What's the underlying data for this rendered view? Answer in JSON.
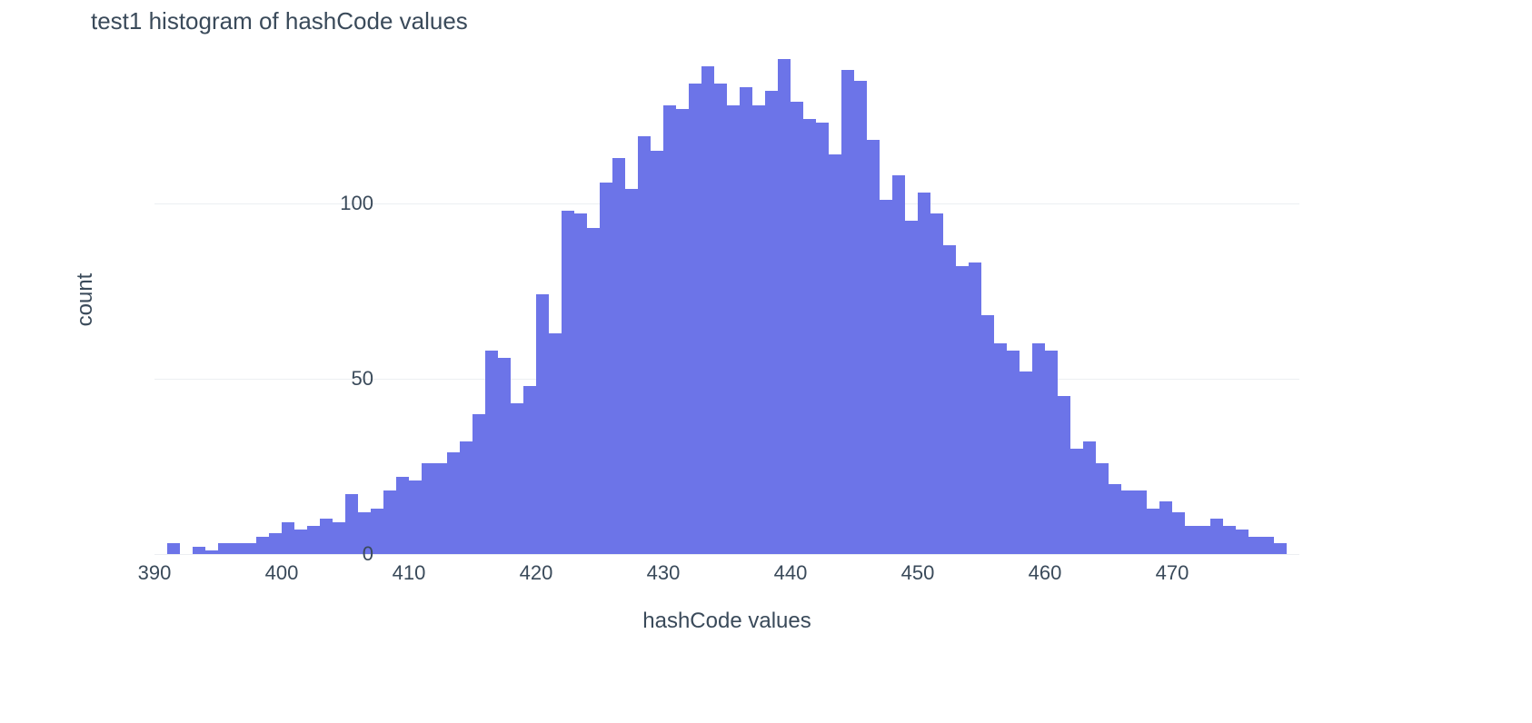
{
  "chart_data": {
    "type": "bar",
    "title": "test1 histogram of hashCode values",
    "xlabel": "hashCode values",
    "ylabel": "count",
    "x_ticks": [
      390,
      400,
      410,
      420,
      430,
      440,
      450,
      460,
      470
    ],
    "y_ticks": [
      0,
      50,
      100
    ],
    "xlim": [
      390,
      480
    ],
    "ylim": [
      0,
      145
    ],
    "categories": [
      390,
      391,
      392,
      393,
      394,
      395,
      396,
      397,
      398,
      399,
      400,
      401,
      402,
      403,
      404,
      405,
      406,
      407,
      408,
      409,
      410,
      411,
      412,
      413,
      414,
      415,
      416,
      417,
      418,
      419,
      420,
      421,
      422,
      423,
      424,
      425,
      426,
      427,
      428,
      429,
      430,
      431,
      432,
      433,
      434,
      435,
      436,
      437,
      438,
      439,
      440,
      441,
      442,
      443,
      444,
      445,
      446,
      447,
      448,
      449,
      450,
      451,
      452,
      453,
      454,
      455,
      456,
      457,
      458,
      459,
      460,
      461,
      462,
      463,
      464,
      465,
      466,
      467,
      468,
      469,
      470,
      471,
      472,
      473,
      474,
      475,
      476,
      477,
      478,
      479
    ],
    "values": [
      0,
      3,
      0,
      2,
      1,
      3,
      3,
      3,
      5,
      6,
      9,
      7,
      8,
      10,
      9,
      17,
      12,
      13,
      18,
      22,
      21,
      26,
      26,
      29,
      32,
      40,
      58,
      56,
      43,
      48,
      74,
      63,
      98,
      97,
      93,
      106,
      113,
      104,
      119,
      115,
      128,
      127,
      134,
      139,
      134,
      128,
      133,
      128,
      132,
      141,
      129,
      124,
      123,
      114,
      138,
      135,
      118,
      101,
      108,
      95,
      103,
      97,
      88,
      82,
      83,
      68,
      60,
      58,
      52,
      60,
      58,
      45,
      30,
      32,
      26,
      20,
      18,
      18,
      13,
      15,
      12,
      8,
      8,
      10,
      8,
      7,
      5,
      5,
      3,
      0
    ]
  }
}
